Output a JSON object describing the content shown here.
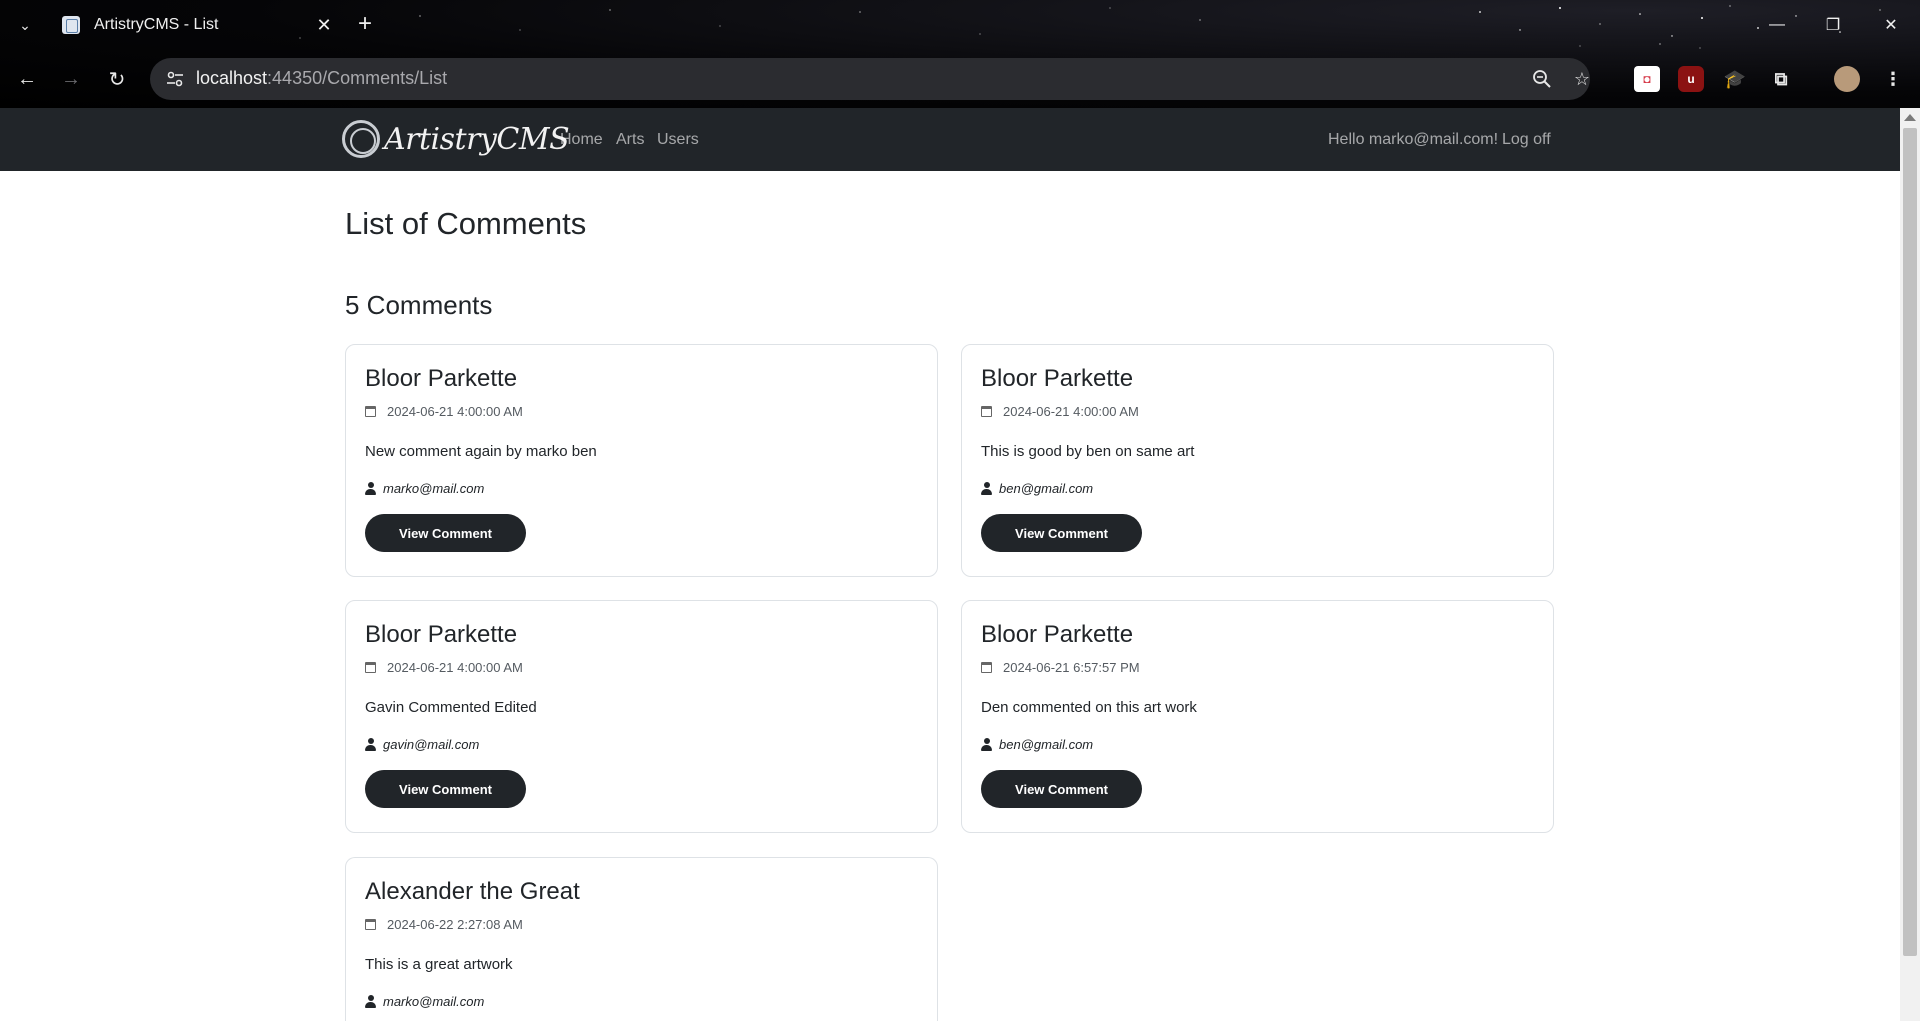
{
  "browser": {
    "tab_title": "ArtistryCMS - List",
    "url_host": "localhost",
    "url_path": ":44350/Comments/List"
  },
  "site": {
    "brand": "ArtistryCMS",
    "nav": [
      "Home",
      "Arts",
      "Users"
    ],
    "greeting": "Hello marko@mail.com!",
    "logoff": "Log off"
  },
  "page": {
    "title": "List of Comments",
    "count_label": "5 Comments",
    "view_label": "View Comment"
  },
  "comments": [
    {
      "art": "Bloor Parkette",
      "date": "2024-06-21 4:00:00 AM",
      "text": "New comment again by marko ben",
      "user": "marko@mail.com"
    },
    {
      "art": "Bloor Parkette",
      "date": "2024-06-21 4:00:00 AM",
      "text": "This is good by ben on same art",
      "user": "ben@gmail.com"
    },
    {
      "art": "Bloor Parkette",
      "date": "2024-06-21 4:00:00 AM",
      "text": "Gavin Commented Edited",
      "user": "gavin@mail.com"
    },
    {
      "art": "Bloor Parkette",
      "date": "2024-06-21 6:57:57 PM",
      "text": "Den commented on this art work",
      "user": "ben@gmail.com"
    },
    {
      "art": "Alexander the Great",
      "date": "2024-06-22 2:27:08 AM",
      "text": "This is a great artwork",
      "user": "marko@mail.com"
    }
  ]
}
